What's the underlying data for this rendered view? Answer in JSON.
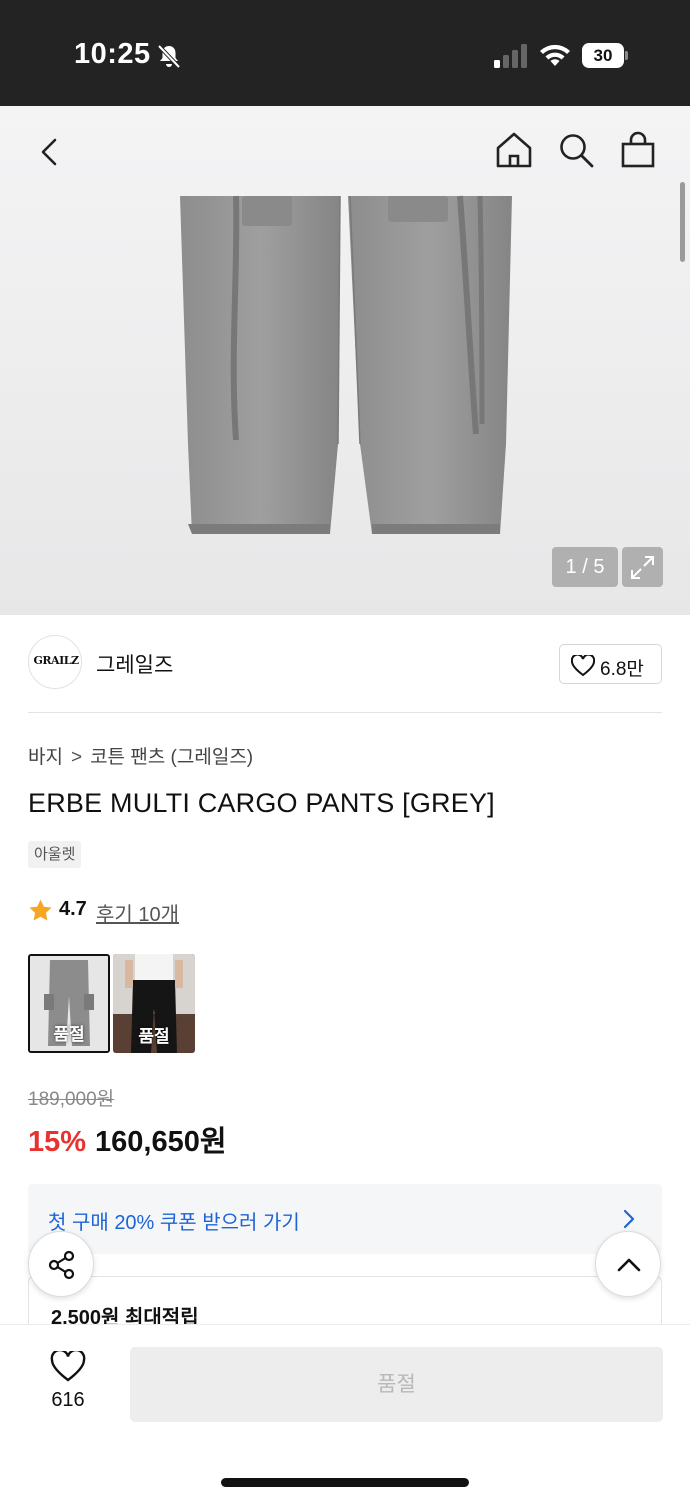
{
  "status_bar": {
    "time": "10:25",
    "battery": "30"
  },
  "gallery": {
    "pager": "1 / 5"
  },
  "brand": {
    "logo_text": "GRAILZ",
    "name": "그레일즈",
    "likes": "6.8만"
  },
  "breadcrumb": {
    "category": "바지",
    "separator": ">",
    "subcategory": "코튼 팬츠 (그레일즈)"
  },
  "product": {
    "title": "ERBE MULTI CARGO PANTS [GREY]",
    "badge": "아울렛",
    "rating": "4.7",
    "review_link": "후기 10개",
    "variants": [
      {
        "label": "품절"
      },
      {
        "label": "품절"
      }
    ],
    "original_price": "189,000원",
    "discount": "15%",
    "sale_price": "160,650원"
  },
  "coupon": {
    "text": "첫 구매 20% 쿠폰 받으러 가기"
  },
  "points": {
    "text": "2,500원 최대적립"
  },
  "bottom": {
    "like_count": "616",
    "buy_label": "품절"
  },
  "colors": {
    "discount_red": "#e8322f",
    "link_blue": "#1d64d6",
    "star": "#f5a623"
  },
  "icons": [
    "bell-slash-icon",
    "signal-icon",
    "wifi-icon",
    "back-icon",
    "home-icon",
    "search-icon",
    "bag-icon",
    "expand-icon",
    "heart-icon",
    "star-icon",
    "chevron-right-icon",
    "share-icon",
    "chevron-up-icon"
  ]
}
